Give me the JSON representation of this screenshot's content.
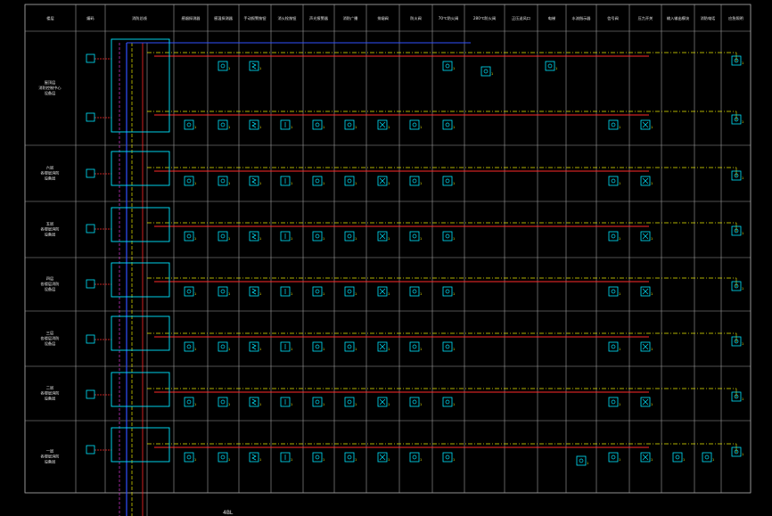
{
  "headers": [
    "楼层",
    "编码",
    "消防总线",
    "感烟探测器",
    "感温探测器",
    "手动报警按钮",
    "消火栓按钮",
    "声光报警器",
    "消防广播",
    "排烟阀",
    "防火阀",
    "70℃防火阀",
    "280℃防火阀",
    "正压送风口",
    "电梯",
    "水流指示器",
    "信号阀",
    "压力开关",
    "输入输出模块",
    "消防电话",
    "应急照明"
  ],
  "floor_labels": [
    [
      "屋顶层",
      "消防控制中心",
      "设备层"
    ],
    [
      "六层",
      "各楼层消防",
      "设备层"
    ],
    [
      "五层",
      "各楼层消防",
      "设备层"
    ],
    [
      "四层",
      "各楼层消防",
      "设备层"
    ],
    [
      "三层",
      "各楼层消防",
      "设备层"
    ],
    [
      "二层",
      "各楼层消防",
      "设备层"
    ],
    [
      "一层",
      "各楼层消防",
      "设备层"
    ]
  ],
  "footer_label": "4BL",
  "colors": {
    "grid": "#a0a0a0",
    "device": "#00e5ff",
    "bus_red": "#ff2a2a",
    "bus_yellow": "#e8e800",
    "bus_blue": "#3050ff",
    "magenta": "#ff40ff",
    "text": "#e8e8e8"
  },
  "icons": [
    "smoke-detector-icon",
    "heat-detector-icon",
    "manual-alarm-icon",
    "hydrant-button-icon",
    "sounder-icon",
    "speaker-icon",
    "damper-icon",
    "fan-icon",
    "telephone-icon",
    "module-icon"
  ]
}
